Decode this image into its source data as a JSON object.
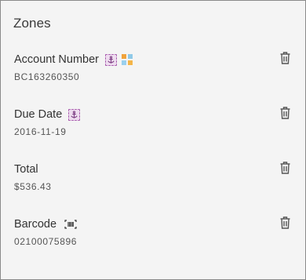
{
  "panel": {
    "title": "Zones"
  },
  "zones": [
    {
      "name": "Account Number",
      "value": "BC163260350"
    },
    {
      "name": "Due Date",
      "value": "2016-11-19"
    },
    {
      "name": "Total",
      "value": "$536.43"
    },
    {
      "name": "Barcode",
      "value": "02100075896"
    }
  ],
  "icons": {
    "anchor": "anchor-icon",
    "grid": "color-grid-icon",
    "barcode": "barcode-icon",
    "delete": "trash-icon"
  },
  "colors": {
    "anchor_badge_fill": "#eedcef",
    "anchor_badge_border": "#b06ab5",
    "icon_gray": "#555555"
  }
}
